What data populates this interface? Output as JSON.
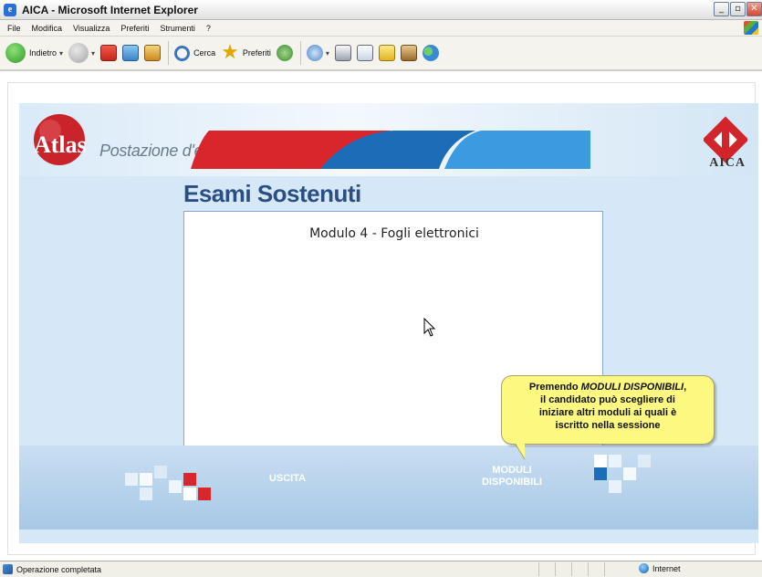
{
  "window": {
    "title": "AICA - Microsoft Internet Explorer",
    "controls": {
      "minimize": "_",
      "maximize": "▫",
      "close": "✕"
    }
  },
  "menu": {
    "items": [
      "File",
      "Modifica",
      "Visualizza",
      "Preferiti",
      "Strumenti",
      "?"
    ]
  },
  "toolbar": {
    "back_label": "Indietro",
    "search_label": "Cerca",
    "favorites_label": "Preferiti"
  },
  "app": {
    "atlas_logo_text": "Atlas",
    "app_name": "Postazione d'esame",
    "aica_logo_text": "AICA",
    "page_title": "Esami Sostenuti",
    "modules": [
      "Modulo 4 - Fogli elettronici"
    ],
    "exit_button": "USCITA",
    "modules_button_line1": "MODULI",
    "modules_button_line2": "DISPONIBILI",
    "callout": {
      "line1_prefix": "Premendo ",
      "line1_emph": "MODULI DISPONIBILI",
      "line1_suffix": ",",
      "line2": "il candidato può scegliere di",
      "line3": "iniziare altri moduli ai quali è",
      "line4": "iscritto nella sessione"
    },
    "colors": {
      "title_blue": "#2b4f83",
      "exit_red": "#d9262c",
      "modules_blue": "#3c9be0",
      "callout_yellow": "#fcf880"
    }
  },
  "status": {
    "text": "Operazione completata",
    "zone": "Internet"
  }
}
